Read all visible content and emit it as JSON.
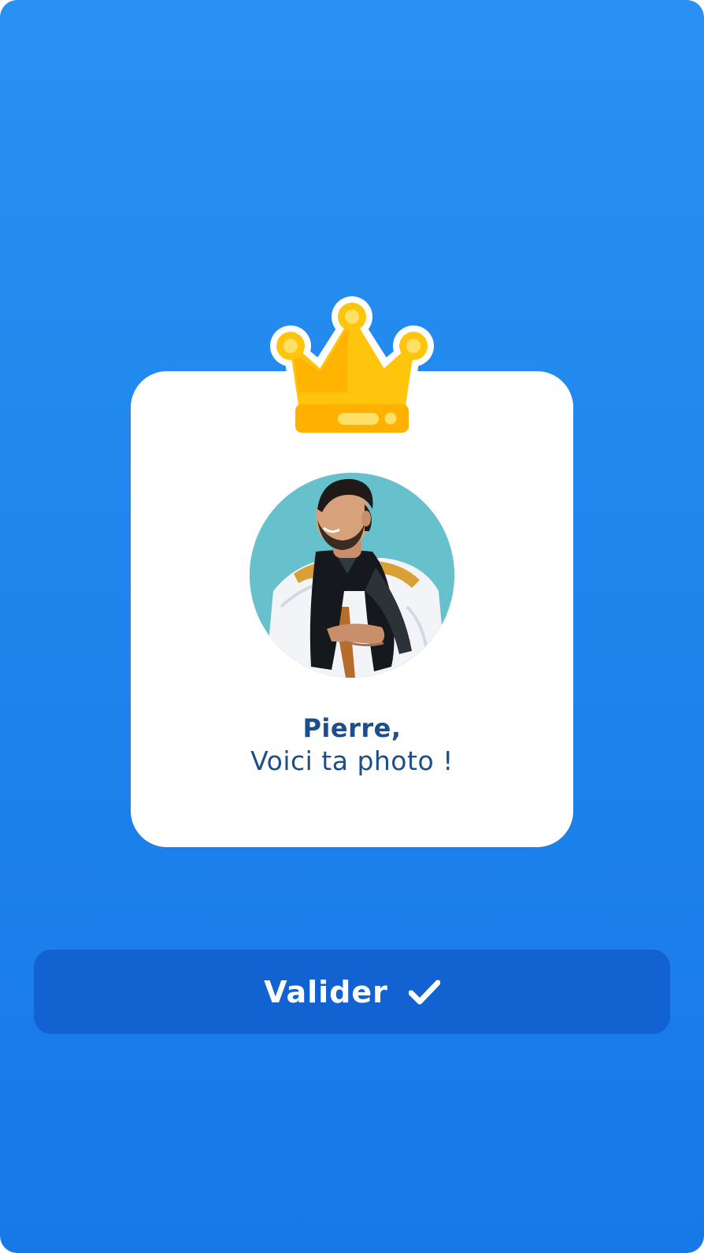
{
  "card": {
    "name": "Pierre,",
    "message": "Voici ta photo !"
  },
  "button": {
    "label": "Valider",
    "icon": "check-icon"
  },
  "colors": {
    "background": "#2189ee",
    "card": "#ffffff",
    "text": "#1b4f8c",
    "button": "#1262d1",
    "crown": "#ffc40c"
  },
  "icons": [
    "crown-icon",
    "check-icon"
  ]
}
